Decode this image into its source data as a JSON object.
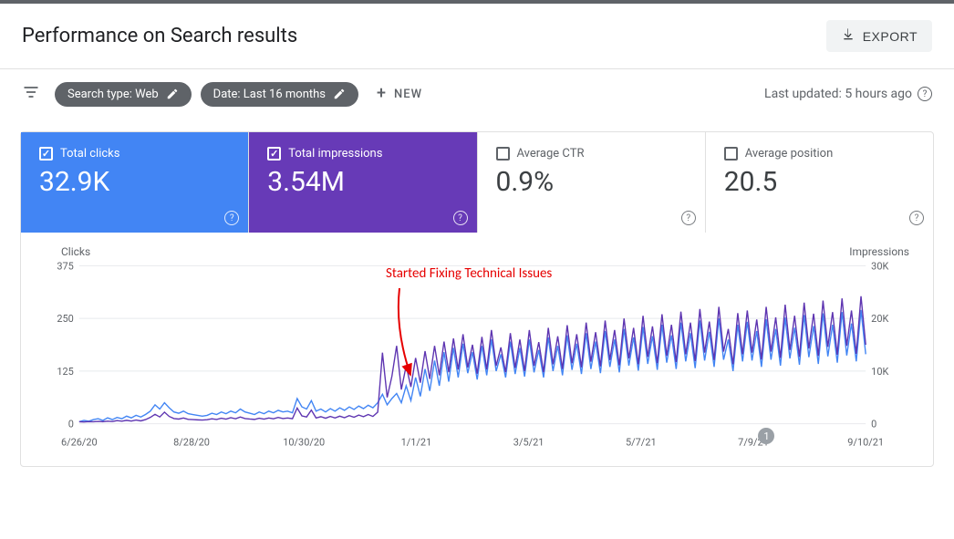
{
  "header": {
    "title": "Performance on Search results",
    "export_label": "EXPORT"
  },
  "filters": {
    "search_type_chip": "Search type: Web",
    "date_chip": "Date: Last 16 months",
    "new_label": "NEW",
    "last_updated": "Last updated: 5 hours ago"
  },
  "metrics": {
    "clicks": {
      "label": "Total clicks",
      "value": "32.9K",
      "checked": true,
      "color": "#4285f4"
    },
    "impressions": {
      "label": "Total impressions",
      "value": "3.54M",
      "checked": true,
      "color": "#673ab7"
    },
    "ctr": {
      "label": "Average CTR",
      "value": "0.9%",
      "checked": false
    },
    "position": {
      "label": "Average position",
      "value": "20.5",
      "checked": false
    }
  },
  "annotation": {
    "text": "Started Fixing Technical Issues"
  },
  "badge": {
    "label": "1"
  },
  "chart_data": {
    "type": "line",
    "xlabel": "",
    "title": "",
    "x_categories": [
      "6/26/20",
      "8/28/20",
      "10/30/20",
      "1/1/21",
      "3/5/21",
      "5/7/21",
      "7/9/21",
      "9/10/21"
    ],
    "left_axis": {
      "label": "Clicks",
      "ticks": [
        0,
        125,
        250,
        375
      ],
      "ylim": [
        0,
        375
      ]
    },
    "right_axis": {
      "label": "Impressions",
      "ticks": [
        "0",
        "10K",
        "20K",
        "30K"
      ],
      "ylim": [
        0,
        30000
      ]
    },
    "series": [
      {
        "name": "Clicks",
        "axis": "left",
        "color": "#4285f4",
        "values": [
          5,
          8,
          6,
          10,
          12,
          8,
          14,
          10,
          15,
          12,
          18,
          14,
          20,
          16,
          22,
          30,
          45,
          35,
          50,
          38,
          28,
          25,
          30,
          24,
          22,
          20,
          18,
          20,
          25,
          22,
          28,
          24,
          30,
          26,
          35,
          28,
          25,
          22,
          28,
          24,
          30,
          26,
          32,
          28,
          30,
          26,
          60,
          40,
          35,
          55,
          30,
          35,
          28,
          36,
          30,
          38,
          32,
          40,
          34,
          42,
          36,
          44,
          38,
          50,
          70,
          45,
          60,
          72,
          50,
          90,
          55,
          110,
          65,
          130,
          78,
          150,
          90,
          170,
          100,
          180,
          110,
          190,
          120,
          170,
          105,
          185,
          115,
          200,
          125,
          165,
          110,
          195,
          118,
          180,
          112,
          200,
          122,
          175,
          110,
          205,
          125,
          185,
          115,
          210,
          128,
          190,
          118,
          215,
          130,
          195,
          120,
          220,
          135,
          200,
          122,
          225,
          138,
          205,
          126,
          230,
          142,
          208,
          128,
          235,
          145,
          210,
          130,
          240,
          148,
          215,
          132,
          245,
          150,
          218,
          135,
          250,
          152,
          200,
          125,
          235,
          148,
          242,
          150,
          220,
          135,
          248,
          152,
          225,
          138,
          252,
          155,
          228,
          140,
          258,
          158,
          232,
          142,
          262,
          160,
          235,
          145,
          265,
          162,
          238,
          148,
          270,
          165
        ]
      },
      {
        "name": "Impressions",
        "axis": "right",
        "color": "#5e35b1",
        "values": [
          400,
          350,
          420,
          380,
          450,
          400,
          500,
          430,
          600,
          500,
          650,
          520,
          700,
          550,
          800,
          1200,
          1800,
          1300,
          2200,
          1400,
          1000,
          900,
          1100,
          850,
          800,
          750,
          700,
          780,
          950,
          830,
          1050,
          880,
          1150,
          940,
          1300,
          1000,
          900,
          820,
          1050,
          880,
          1100,
          940,
          1200,
          1000,
          1100,
          960,
          3000,
          1500,
          1300,
          2600,
          1100,
          1350,
          1050,
          1400,
          1100,
          1450,
          1150,
          1550,
          1250,
          1650,
          1350,
          1750,
          1400,
          2200,
          13500,
          5000,
          9000,
          14800,
          6500,
          11000,
          7000,
          12500,
          7800,
          13800,
          8500,
          14800,
          9200,
          15600,
          9800,
          16200,
          10300,
          17000,
          10700,
          15000,
          9500,
          16500,
          10300,
          17800,
          11000,
          14500,
          9800,
          17200,
          10600,
          16000,
          10000,
          17800,
          11000,
          15500,
          9800,
          18200,
          11300,
          16600,
          10400,
          18700,
          11500,
          17000,
          10700,
          19200,
          11800,
          17400,
          10900,
          19600,
          12100,
          17800,
          11100,
          20000,
          12400,
          18200,
          11300,
          20500,
          12700,
          18500,
          11500,
          20800,
          12900,
          18800,
          11700,
          21300,
          13200,
          19200,
          11900,
          21800,
          13500,
          19400,
          12100,
          22200,
          13700,
          18000,
          11300,
          21000,
          13200,
          21500,
          13500,
          19800,
          12200,
          22200,
          13700,
          20200,
          12500,
          22600,
          14000,
          20500,
          12700,
          23000,
          14300,
          20900,
          12900,
          23400,
          14600,
          21200,
          13100,
          23800,
          14800,
          21500,
          13300,
          24200,
          15000
        ]
      }
    ]
  }
}
